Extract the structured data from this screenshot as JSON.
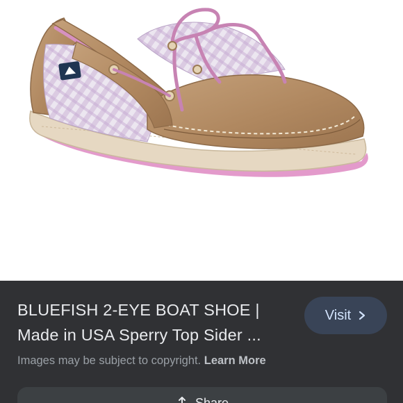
{
  "result": {
    "title_line1": "BLUEFISH 2-EYE BOAT SHOE |",
    "title_line2": "Made in USA Sperry Top Sider ...",
    "visit_label": "Visit",
    "copyright_text": "Images may be subject to copyright.",
    "learn_more_label": "Learn More",
    "share_label": "Share"
  },
  "icons": {
    "visit": "chevron-right-icon",
    "share": "share-icon"
  },
  "colors": {
    "panel_bg": "#303134",
    "visit_button_bg": "#394457",
    "visit_text": "#d2e3fc",
    "share_button_bg": "#3c4043"
  }
}
